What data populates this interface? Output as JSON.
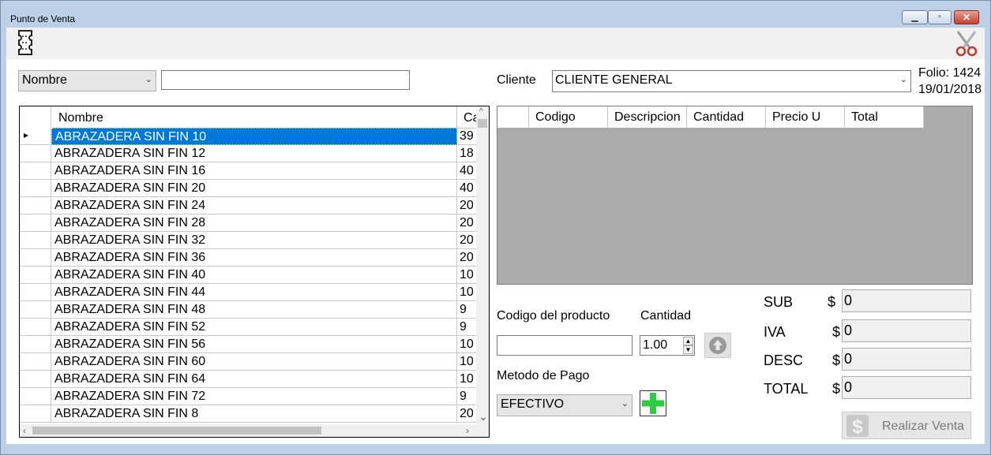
{
  "window": {
    "title": "Punto de Venta"
  },
  "search": {
    "field_selected": "Nombre",
    "query_value": ""
  },
  "client": {
    "label": "Cliente",
    "selected": "CLIENTE GENERAL"
  },
  "folio": {
    "text": "Folio: 1424",
    "date": "19/01/2018"
  },
  "products": {
    "columns": [
      "Nombre",
      "Ca"
    ],
    "rows": [
      {
        "name": "ABRAZADERA SIN FIN 10",
        "qty": "39"
      },
      {
        "name": "ABRAZADERA SIN FIN 12",
        "qty": "18"
      },
      {
        "name": "ABRAZADERA SIN FIN 16",
        "qty": "40"
      },
      {
        "name": "ABRAZADERA SIN FIN 20",
        "qty": "40"
      },
      {
        "name": "ABRAZADERA SIN FIN 24",
        "qty": "20"
      },
      {
        "name": "ABRAZADERA SIN FIN 28",
        "qty": "20"
      },
      {
        "name": "ABRAZADERA SIN FIN 32",
        "qty": "20"
      },
      {
        "name": "ABRAZADERA SIN FIN 36",
        "qty": "20"
      },
      {
        "name": "ABRAZADERA SIN FIN 40",
        "qty": "10"
      },
      {
        "name": "ABRAZADERA SIN FIN 44",
        "qty": "10"
      },
      {
        "name": "ABRAZADERA SIN FIN 48",
        "qty": "9"
      },
      {
        "name": "ABRAZADERA SIN FIN 52",
        "qty": "9"
      },
      {
        "name": "ABRAZADERA SIN FIN 56",
        "qty": "10"
      },
      {
        "name": "ABRAZADERA SIN FIN 60",
        "qty": "10"
      },
      {
        "name": "ABRAZADERA SIN FIN 64",
        "qty": "10"
      },
      {
        "name": "ABRAZADERA SIN FIN 72",
        "qty": "9"
      },
      {
        "name": "ABRAZADERA SIN FIN 8",
        "qty": "20"
      }
    ]
  },
  "sale": {
    "columns": [
      "Codigo",
      "Descripcion",
      "Cantidad",
      "Precio U",
      "Total"
    ]
  },
  "entry": {
    "code_label": "Codigo del producto",
    "code_value": "",
    "qty_label": "Cantidad",
    "qty_value": "1.00",
    "payment_label": "Metodo de Pago",
    "payment_selected": "EFECTIVO"
  },
  "totals": {
    "sub_label": "SUB",
    "sub_value": "0",
    "iva_label": "IVA",
    "iva_value": "0",
    "desc_label": "DESC",
    "desc_value": "0",
    "total_label": "TOTAL",
    "total_value": "0",
    "currency": "$"
  },
  "actions": {
    "checkout_label": "Realizar Venta"
  },
  "colors": {
    "selection": "#0078d7",
    "add_green": "#2ecc40",
    "sale_grid_bg": "#ababab"
  }
}
